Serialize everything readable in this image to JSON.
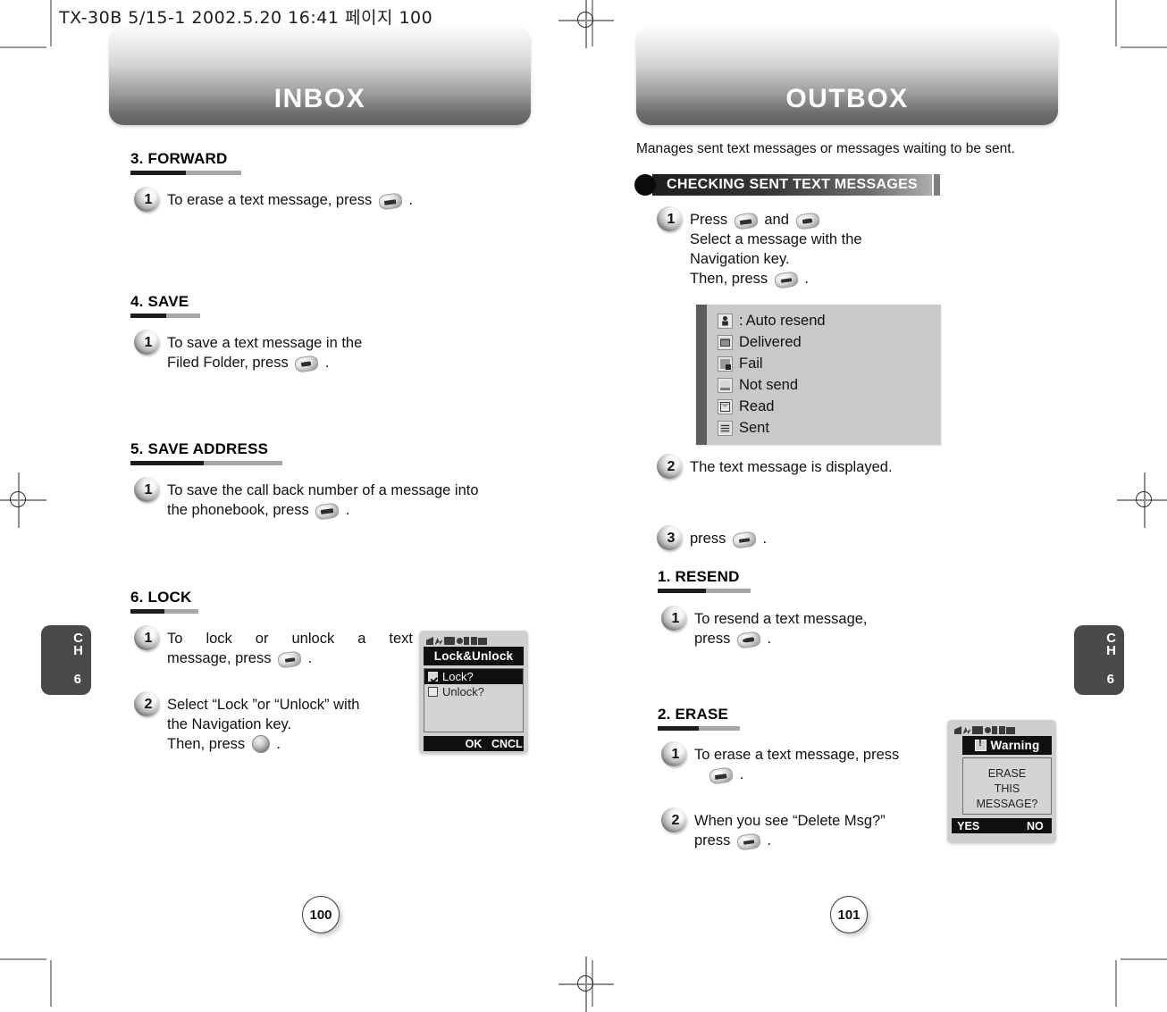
{
  "film_header": "TX-30B 5/15-1  2002.5.20 16:41 페이지 100",
  "chapter_tab": {
    "ch_label": "CH",
    "number": "6"
  },
  "left_page": {
    "banner_title": "INBOX",
    "page_number": "100",
    "sections": [
      {
        "heading": "3. FORWARD",
        "steps": [
          {
            "num": "1",
            "text_before": "To erase a text message, press",
            "key": "message-key",
            "text_after": "."
          }
        ]
      },
      {
        "heading": "4. SAVE",
        "steps": [
          {
            "num": "1",
            "line1": "To save a text message in the",
            "line2_before": "Filed Folder, press",
            "key": "file-key",
            "line2_after": "."
          }
        ]
      },
      {
        "heading": "5. SAVE ADDRESS",
        "steps": [
          {
            "num": "1",
            "line1": "To save the call back number of a message into",
            "line2_before": "the phonebook, press",
            "key": "save-key",
            "line2_after": "."
          }
        ]
      },
      {
        "heading": "6. LOCK",
        "steps": [
          {
            "num": "1",
            "line1": "To lock or unlock a text",
            "line2_before": "message, press",
            "key": "lock-key",
            "line2_after": "."
          },
          {
            "num": "2",
            "line1": "Select “Lock ”or “Unlock” with",
            "line2": "the Navigation key.",
            "line3_before": "Then, press",
            "key": "ok-key",
            "line3_after": "."
          }
        ]
      }
    ],
    "phone_screen": {
      "title": "Lock&Unlock",
      "items": [
        {
          "label": "Lock?",
          "checked": true,
          "selected": true
        },
        {
          "label": "Unlock?",
          "checked": false,
          "selected": false
        }
      ],
      "softkeys": [
        "",
        "OK",
        "CNCL"
      ]
    }
  },
  "right_page": {
    "banner_title": "OUTBOX",
    "page_number": "101",
    "intro": "Manages sent text messages or messages waiting to be sent.",
    "dark_heading": "CHECKING SENT TEXT MESSAGES",
    "steps": [
      {
        "num": "1",
        "line1_before": "Press",
        "key1": "message-key",
        "line1_mid": "and",
        "key2": "file-key",
        "line2": "Select a message with the",
        "line3": "Navigation key.",
        "line4_before": "Then, press",
        "key3": "send-key",
        "line4_after": "."
      },
      {
        "num": "2",
        "text": "The text message is displayed."
      },
      {
        "num": "3",
        "text_before": "press",
        "key": "send-key",
        "text_after": "."
      }
    ],
    "legend": [
      {
        "icon": "auto-resend-icon",
        "colon": ":",
        "label": "Auto resend"
      },
      {
        "icon": "delivered-icon",
        "colon": "",
        "label": "Delivered"
      },
      {
        "icon": "fail-icon",
        "colon": "",
        "label": "Fail"
      },
      {
        "icon": "not-send-icon",
        "colon": "",
        "label": "Not send"
      },
      {
        "icon": "read-icon",
        "colon": "",
        "label": "Read"
      },
      {
        "icon": "sent-icon",
        "colon": "",
        "label": "Sent"
      }
    ],
    "sections": [
      {
        "heading": "1. RESEND",
        "steps": [
          {
            "num": "1",
            "line1": "To resend a text message,",
            "line2_before": "press",
            "key": "resend-key",
            "line2_after": "."
          }
        ]
      },
      {
        "heading": "2. ERASE",
        "steps": [
          {
            "num": "1",
            "line1_before": "To erase a text message, press",
            "key": "message-key",
            "line2_after": "."
          },
          {
            "num": "2",
            "line1": "When you see “Delete Msg?”",
            "line2_before": "press",
            "key": "send-key",
            "line2_after": "."
          }
        ]
      }
    ],
    "phone_screen": {
      "title": "Warning",
      "body_line1": "ERASE",
      "body_line2": "THIS MESSAGE?",
      "softkeys": [
        "YES",
        "",
        "NO"
      ]
    }
  }
}
